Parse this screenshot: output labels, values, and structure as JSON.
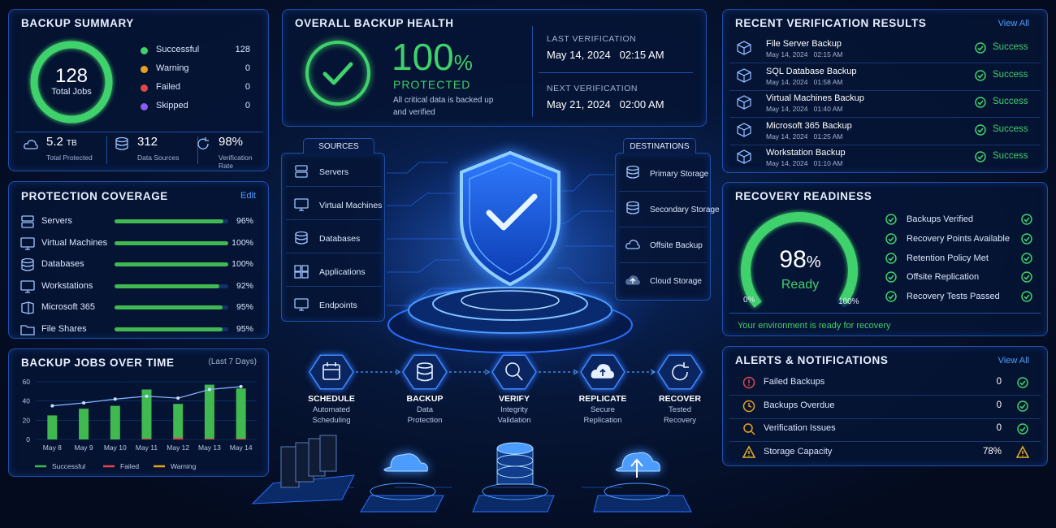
{
  "summary": {
    "title": "BACKUP SUMMARY",
    "total": "128",
    "total_label": "Total Jobs",
    "legend": [
      {
        "label": "Successful",
        "value": "128",
        "color": "#3fd16b"
      },
      {
        "label": "Warning",
        "value": "0",
        "color": "#e8a020"
      },
      {
        "label": "Failed",
        "value": "0",
        "color": "#e04848"
      },
      {
        "label": "Skipped",
        "value": "0",
        "color": "#8a5cf0"
      }
    ],
    "stats": [
      {
        "value": "5.2",
        "unit": "TB",
        "label": "Total Protected",
        "icon": "cloud-icon"
      },
      {
        "value": "312",
        "unit": "",
        "label": "Data Sources",
        "icon": "database-icon"
      },
      {
        "value": "98%",
        "unit": "",
        "label": "Verification Rate",
        "icon": "refresh-icon"
      }
    ]
  },
  "coverage": {
    "title": "PROTECTION COVERAGE",
    "edit": "Edit",
    "items": [
      {
        "label": "Servers",
        "pct": 96,
        "text": "96%",
        "icon": "server-icon"
      },
      {
        "label": "Virtual Machines",
        "pct": 100,
        "text": "100%",
        "icon": "monitor-icon"
      },
      {
        "label": "Databases",
        "pct": 100,
        "text": "100%",
        "icon": "database-icon"
      },
      {
        "label": "Workstations",
        "pct": 92,
        "text": "92%",
        "icon": "desktop-icon"
      },
      {
        "label": "Microsoft 365",
        "pct": 95,
        "text": "95%",
        "icon": "office-icon"
      },
      {
        "label": "File Shares",
        "pct": 95,
        "text": "95%",
        "icon": "folder-icon"
      }
    ]
  },
  "jobs_chart": {
    "title": "BACKUP JOBS OVER TIME",
    "period": "(Last 7 Days)"
  },
  "chart_data": {
    "type": "bar",
    "categories": [
      "May 8",
      "May 9",
      "May 10",
      "May 11",
      "May 12",
      "May 13",
      "May 14"
    ],
    "yticks": [
      "60",
      "40",
      "20",
      "0"
    ],
    "ylim": [
      0,
      60
    ],
    "series": [
      {
        "name": "Successful",
        "values": [
          25,
          32,
          35,
          52,
          37,
          57,
          53
        ],
        "color": "#3fb950"
      },
      {
        "name": "Failed",
        "values": [
          0,
          0,
          0,
          1,
          2,
          1,
          1
        ],
        "color": "#e04848"
      },
      {
        "name": "Warning",
        "values": [
          0,
          0,
          0,
          0,
          0,
          0,
          0
        ],
        "color": "#e8a020"
      }
    ],
    "trend": [
      35,
      38,
      42,
      45,
      43,
      52,
      55
    ]
  },
  "health": {
    "title": "OVERALL BACKUP HEALTH",
    "percent": "100",
    "pct_sign": "%",
    "status": "PROTECTED",
    "desc1": "All critical data is backed up",
    "desc2": "and verified",
    "last_label": "LAST VERIFICATION",
    "last_value": "May 14, 2024   02:15 AM",
    "next_label": "NEXT VERIFICATION",
    "next_value": "May 21, 2024   02:00 AM"
  },
  "sources": {
    "title": "SOURCES",
    "items": [
      "Servers",
      "Virtual Machines",
      "Databases",
      "Applications",
      "Endpoints"
    ]
  },
  "destinations": {
    "title": "DESTINATIONS",
    "items": [
      "Primary Storage",
      "Secondary Storage",
      "Offsite Backup",
      "Cloud Storage"
    ]
  },
  "pipeline": [
    {
      "title": "SCHEDULE",
      "l1": "Automated",
      "l2": "Scheduling",
      "icon": "calendar-icon"
    },
    {
      "title": "BACKUP",
      "l1": "Data",
      "l2": "Protection",
      "icon": "database-icon"
    },
    {
      "title": "VERIFY",
      "l1": "Integrity",
      "l2": "Validation",
      "icon": "search-icon"
    },
    {
      "title": "REPLICATE",
      "l1": "Secure",
      "l2": "Replication",
      "icon": "cloud-upload-icon"
    },
    {
      "title": "RECOVER",
      "l1": "Tested",
      "l2": "Recovery",
      "icon": "refresh-icon"
    }
  ],
  "verification": {
    "title": "RECENT VERIFICATION RESULTS",
    "view_all": "View All",
    "items": [
      {
        "name": "File Server Backup",
        "date": "May 14, 2024   02:15 AM",
        "status": "Success"
      },
      {
        "name": "SQL Database Backup",
        "date": "May 14, 2024   01:58 AM",
        "status": "Success"
      },
      {
        "name": "Virtual Machines Backup",
        "date": "May 14, 2024   01:40 AM",
        "status": "Success"
      },
      {
        "name": "Microsoft 365 Backup",
        "date": "May 14, 2024   01:25 AM",
        "status": "Success"
      },
      {
        "name": "Workstation Backup",
        "date": "May 14, 2024   01:10 AM",
        "status": "Success"
      }
    ]
  },
  "recovery": {
    "title": "RECOVERY READINESS",
    "percent": "98",
    "pct_sign": "%",
    "value": 98,
    "status": "Ready",
    "min": "0%",
    "max": "100%",
    "checks": [
      "Backups Verified",
      "Recovery Points Available",
      "Retention Policy Met",
      "Offsite Replication",
      "Recovery Tests Passed"
    ],
    "footer": "Your environment is ready for recovery"
  },
  "alerts": {
    "title": "ALERTS & NOTIFICATIONS",
    "view_all": "View All",
    "items": [
      {
        "label": "Failed Backups",
        "value": "0",
        "icon": "error-icon",
        "color": "#e04848",
        "state": "ok"
      },
      {
        "label": "Backups Overdue",
        "value": "0",
        "icon": "clock-icon",
        "color": "#e8a020",
        "state": "ok"
      },
      {
        "label": "Verification Issues",
        "value": "0",
        "icon": "search-alert-icon",
        "color": "#e8a020",
        "state": "ok"
      },
      {
        "label": "Storage Capacity",
        "value": "78%",
        "icon": "warning-icon",
        "color": "#e8b020",
        "state": "warn"
      }
    ]
  }
}
